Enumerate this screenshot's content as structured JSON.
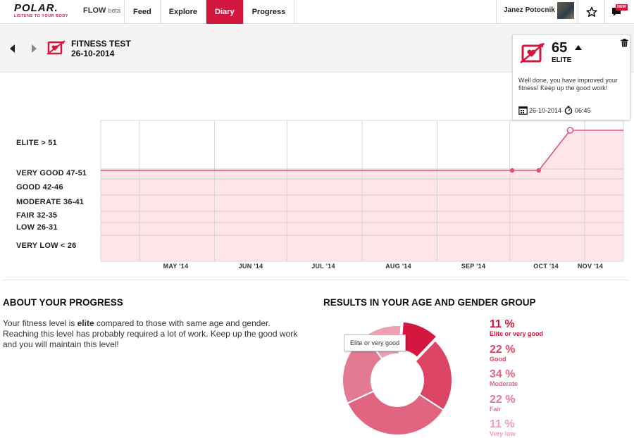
{
  "app": {
    "logo_text": "POLAR.",
    "logo_tagline": "LISTENS TO YOUR BODY",
    "product": "FLOW",
    "product_badge": "beta"
  },
  "nav": {
    "tabs": [
      {
        "label": "Feed"
      },
      {
        "label": "Explore"
      },
      {
        "label": "Diary",
        "active": true
      },
      {
        "label": "Progress"
      }
    ],
    "user_name": "Janez Potocnik",
    "new_badge": "NEW"
  },
  "header": {
    "title": "FITNESS TEST",
    "date": "26-10-2014"
  },
  "result_card": {
    "value": "65",
    "level": "ELITE",
    "message": "Well done, you have improved your fitness! Keep up the good work!",
    "date": "26-10-2014",
    "time": "06:45"
  },
  "chart_data": {
    "type": "line",
    "y_categories": [
      {
        "label": "ELITE > 51"
      },
      {
        "label": "VERY GOOD 47-51"
      },
      {
        "label": "GOOD 42-46"
      },
      {
        "label": "MODERATE 36-41"
      },
      {
        "label": "FAIR 32-35"
      },
      {
        "label": "LOW 26-31"
      },
      {
        "label": "VERY LOW < 26"
      }
    ],
    "x_categories": [
      "MAY '14",
      "JUN '14",
      "JUL '14",
      "AUG '14",
      "SEP '14",
      "OCT '14",
      "NOV '14"
    ],
    "series": [
      {
        "points": [
          {
            "x": "2014-04-15",
            "level": "VERY GOOD 47-51"
          },
          {
            "x": "2014-10-02",
            "level": "VERY GOOD 47-51",
            "marker": true
          },
          {
            "x": "2014-10-13",
            "level": "VERY GOOD 47-51",
            "marker": true
          },
          {
            "x": "2014-10-26",
            "value": 65,
            "level": "ELITE > 51",
            "marker": true,
            "selected": true
          },
          {
            "x": "2014-11-17",
            "level": "ELITE > 51"
          }
        ]
      }
    ],
    "grid": true,
    "color": "#e0507a",
    "fill": "#fde5ea"
  },
  "about": {
    "heading": "ABOUT YOUR PROGRESS",
    "text_before": "Your fitness level is ",
    "text_bold": "elite",
    "text_after": " compared to those with same age and gender. Reaching this level has probably required a lot of work. Keep up the good work and you will maintain this level!"
  },
  "results": {
    "heading": "RESULTS IN YOUR AGE AND GENDER GROUP",
    "tooltip": "Elite or very good",
    "donut": {
      "type": "pie",
      "slices": [
        {
          "label": "Elite or very good",
          "value": 11,
          "pct": "11 %",
          "color": "#d3173f"
        },
        {
          "label": "Good",
          "value": 22,
          "pct": "22 %",
          "color": "#dc4563"
        },
        {
          "label": "Moderate",
          "value": 34,
          "pct": "34 %",
          "color": "#e16580"
        },
        {
          "label": "Fair",
          "value": 22,
          "pct": "22 %",
          "color": "#e27a91"
        },
        {
          "label": "Very low",
          "value": 11,
          "pct": "11 %",
          "color": "#ee9fb1"
        }
      ]
    }
  }
}
